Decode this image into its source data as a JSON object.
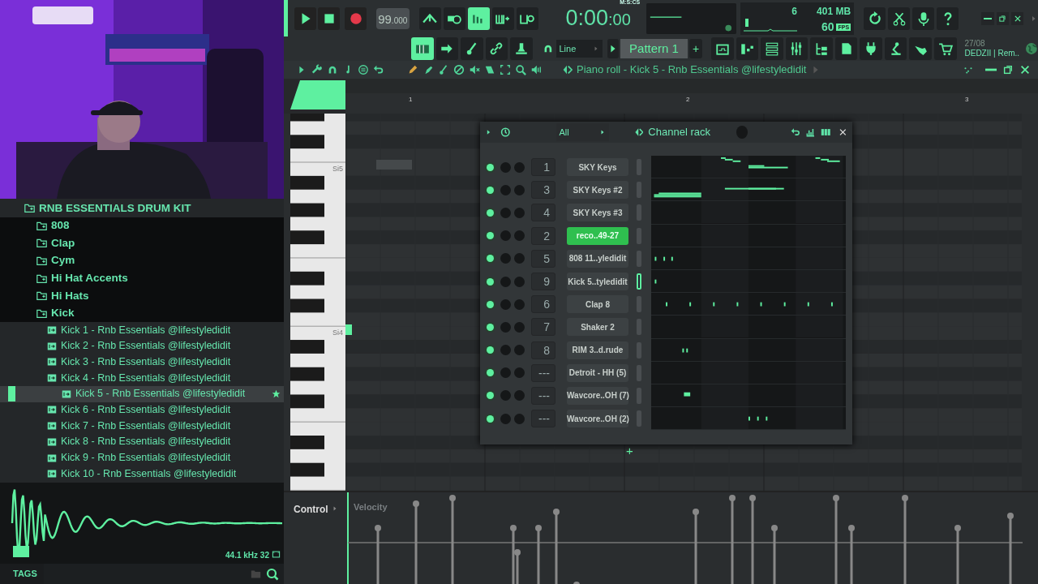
{
  "transport": {
    "tempo": "99",
    "tempo_fraction": ".000",
    "time": "0:00",
    "time_cs": ":00",
    "time_format": "M:S:CS"
  },
  "mode_buttons": [
    {
      "on": false
    },
    {
      "on": false
    },
    {
      "on": true
    },
    {
      "on": false
    },
    {
      "on": false
    }
  ],
  "edit_buttons": [
    {
      "on": true
    },
    {
      "on": false
    },
    {
      "on": false
    },
    {
      "on": false
    },
    {
      "on": false
    }
  ],
  "monitor": {
    "cpu": "6",
    "memory": "401 MB",
    "fps": "60",
    "fps_unit": "FPS"
  },
  "snap": {
    "value": "Line"
  },
  "pattern": {
    "name": "Pattern 1",
    "add": "+"
  },
  "hint": {
    "date": "27/08",
    "text": "DEDZII | Rem.."
  },
  "browser": {
    "tree": [
      {
        "label": "RNB ESSENTIALS DRUM KIT",
        "kind": "folder",
        "children": [
          {
            "label": "808",
            "kind": "folder"
          },
          {
            "label": "Clap",
            "kind": "folder"
          },
          {
            "label": "Cym",
            "kind": "folder"
          },
          {
            "label": "Hi Hat Accents",
            "kind": "folder"
          },
          {
            "label": "Hi Hats",
            "kind": "folder"
          },
          {
            "label": "Kick",
            "kind": "folder",
            "children": [
              {
                "label": "Kick 1 - Rnb Essentials @lifestyledidit",
                "kind": "file",
                "selected": false
              },
              {
                "label": "Kick 2 - Rnb Essentials @lifestyledidit",
                "kind": "file",
                "selected": false
              },
              {
                "label": "Kick 3 - Rnb Essentials @lifestyledidit",
                "kind": "file",
                "selected": false
              },
              {
                "label": "Kick 4 - Rnb Essentials @lifestyledidit",
                "kind": "file",
                "selected": false
              },
              {
                "label": "Kick 5 - Rnb Essentials @lifestyledidit",
                "kind": "file",
                "selected": true
              },
              {
                "label": "Kick 6 - Rnb Essentials @lifestyledidit",
                "kind": "file",
                "selected": false
              },
              {
                "label": "Kick 7 - Rnb Essentials @lifestyledidit",
                "kind": "file",
                "selected": false
              },
              {
                "label": "Kick 8 - Rnb Essentials @lifestyledidit",
                "kind": "file",
                "selected": false
              },
              {
                "label": "Kick 9 - Rnb Essentials @lifestyledidit",
                "kind": "file",
                "selected": false
              },
              {
                "label": "Kick 10 - Rnb Essentials @lifestyledidit",
                "kind": "file",
                "selected": false
              }
            ]
          }
        ]
      }
    ]
  },
  "sample_preview": {
    "info": "44.1 kHz 32"
  },
  "tags": {
    "label": "TAGS"
  },
  "piano_roll": {
    "title": "Piano roll - Kick 5 - Rnb Essentials @lifestyledidit",
    "bars": [
      "1",
      "2",
      "3"
    ],
    "key_labels": [
      "Si5",
      "Si4"
    ],
    "control": "Control",
    "parameter": "Velocity"
  },
  "channel_rack": {
    "title": "Channel rack",
    "filter": "All",
    "add": "+",
    "channels": [
      {
        "number": "1",
        "name": "SKY Keys",
        "highlighted": false,
        "selected": false
      },
      {
        "number": "3",
        "name": "SKY Keys #2",
        "highlighted": false,
        "selected": false
      },
      {
        "number": "4",
        "name": "SKY Keys #3",
        "highlighted": false,
        "selected": false
      },
      {
        "number": "2",
        "name": "reco..49-27",
        "highlighted": true,
        "selected": false
      },
      {
        "number": "5",
        "name": "808 11..yledidit",
        "highlighted": false,
        "selected": false
      },
      {
        "number": "9",
        "name": "Kick 5..tyledidit",
        "highlighted": false,
        "selected": true
      },
      {
        "number": "6",
        "name": "Clap 8",
        "highlighted": false,
        "selected": false
      },
      {
        "number": "7",
        "name": "Shaker 2",
        "highlighted": false,
        "selected": false
      },
      {
        "number": "8",
        "name": "RIM 3..d.rude",
        "highlighted": false,
        "selected": false
      },
      {
        "number": "---",
        "name": "Detroit - HH (5)",
        "highlighted": false,
        "selected": false
      },
      {
        "number": "---",
        "name": "Wavcore..OH (7)",
        "highlighted": false,
        "selected": false
      },
      {
        "number": "---",
        "name": "Wavcore..OH (2)",
        "highlighted": false,
        "selected": false
      }
    ]
  }
}
